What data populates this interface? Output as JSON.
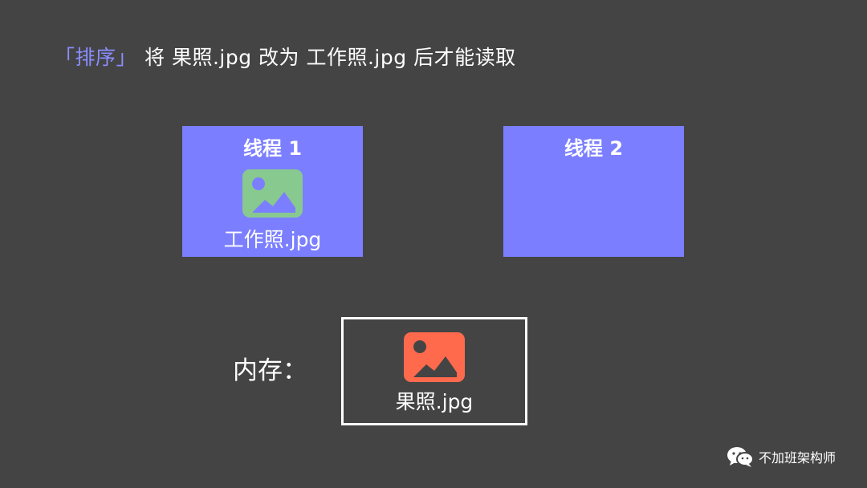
{
  "headline": {
    "accent_text": "「排序」",
    "text": "将 果照.jpg 改为 工作照.jpg 后才能读取"
  },
  "threads": [
    {
      "title": "线程 1",
      "file": "工作照.jpg",
      "icon": "image-icon",
      "icon_color": "#88c98f"
    },
    {
      "title": "线程 2"
    }
  ],
  "memory": {
    "label": "内存：",
    "file": "果照.jpg",
    "icon": "image-icon",
    "icon_color": "#ff6a4d"
  },
  "watermark": {
    "icon": "wechat-icon",
    "text": "不加班架构师"
  },
  "colors": {
    "background": "#444444",
    "thread_box": "#7b7fff",
    "accent": "#8a8dff"
  }
}
